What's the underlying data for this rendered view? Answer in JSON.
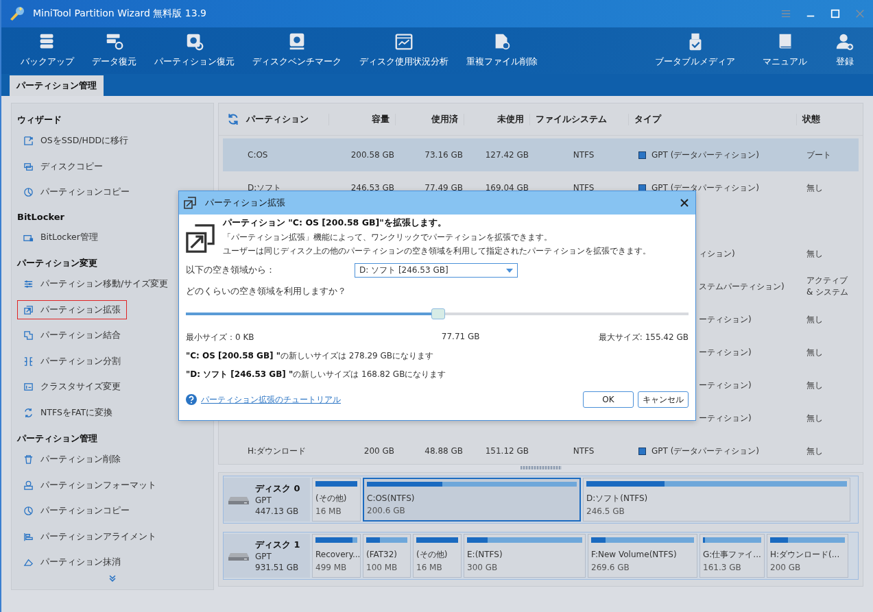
{
  "window": {
    "title": "MiniTool Partition Wizard 無料版 13.9"
  },
  "toolbar": {
    "left": [
      "バックアップ",
      "データ復元",
      "パーティション復元",
      "ディスクベンチマーク",
      "ディスク使用状況分析",
      "重複ファイル削除"
    ],
    "right": [
      "ブータブルメディア",
      "マニュアル",
      "登録"
    ]
  },
  "tabs": [
    {
      "label": "パーティション管理",
      "selected": true
    }
  ],
  "sidebar": [
    {
      "heading": "ウィザード",
      "items": [
        {
          "label": "OSをSSD/HDDに移行",
          "selected": false
        },
        {
          "label": "ディスクコピー",
          "selected": false
        },
        {
          "label": "パーティションコピー",
          "selected": false
        }
      ]
    },
    {
      "heading": "BitLocker",
      "items": [
        {
          "label": "BitLocker管理",
          "selected": false
        }
      ]
    },
    {
      "heading": "パーティション変更",
      "items": [
        {
          "label": "パーティション移動/サイズ変更",
          "selected": false
        },
        {
          "label": "パーティション拡張",
          "selected": true
        },
        {
          "label": "パーティション結合",
          "selected": false
        },
        {
          "label": "パーティション分割",
          "selected": false
        },
        {
          "label": "クラスタサイズ変更",
          "selected": false
        },
        {
          "label": "NTFSをFATに変換",
          "selected": false
        }
      ]
    },
    {
      "heading": "パーティション管理",
      "items": [
        {
          "label": "パーティション削除",
          "selected": false
        },
        {
          "label": "パーティションフォーマット",
          "selected": false
        },
        {
          "label": "パーティションコピー",
          "selected": false
        },
        {
          "label": "パーティションアライメント",
          "selected": false
        },
        {
          "label": "パーティション抹消",
          "selected": false
        }
      ]
    }
  ],
  "table": {
    "columns": [
      "パーティション",
      "容量",
      "使用済",
      "未使用",
      "ファイルシステム",
      "タイプ",
      "状態"
    ],
    "rows": [
      {
        "partition": "C:OS",
        "capacity": "200.58 GB",
        "used": "73.16 GB",
        "unused": "127.42 GB",
        "filesystem": "NTFS",
        "type": "GPT (データパーティション)",
        "status": "ブート",
        "selected": true
      },
      {
        "partition": "D:ソフト",
        "capacity": "246.53 GB",
        "used": "77.49 GB",
        "unused": "169.04 GB",
        "filesystem": "NTFS",
        "type": "GPT (データパーティション)",
        "status": "無し",
        "selected": false
      },
      {
        "type": "ィション)",
        "status": "無し"
      },
      {
        "type": "ステムパーティション)",
        "status": "アクティブ & システム"
      },
      {
        "type": "ーティション)",
        "status": "無し"
      },
      {
        "type": "ーティション)",
        "status": "無し"
      },
      {
        "type": "ーティション)",
        "status": "無し"
      },
      {
        "type": "ーティション)",
        "status": "無し"
      },
      {
        "partition": "H:ダウンロード",
        "capacity": "200 GB",
        "used": "48.88 GB",
        "unused": "151.12 GB",
        "filesystem": "NTFS",
        "type": "GPT (データパーティション)",
        "status": "無し",
        "selected": false
      }
    ]
  },
  "disks": [
    {
      "name": "ディスク 0",
      "style": "GPT",
      "size": "447.13 GB",
      "partitions": [
        {
          "label": "(その他)",
          "size": "16 MB",
          "level": 1.0,
          "selected": false
        },
        {
          "label": "C:OS(NTFS)",
          "size": "200.6 GB",
          "level": 0.36,
          "selected": true
        },
        {
          "label": "D:ソフト(NTFS)",
          "size": "246.5 GB",
          "level": 0.3,
          "selected": false
        }
      ]
    },
    {
      "name": "ディスク 1",
      "style": "GPT",
      "size": "931.51 GB",
      "partitions": [
        {
          "label": "Recovery...",
          "size": "499 MB",
          "level": 0.88,
          "selected": false
        },
        {
          "label": "(FAT32)",
          "size": "100 MB",
          "level": 0.33,
          "selected": false
        },
        {
          "label": "(その他)",
          "size": "16 MB",
          "level": 1.0,
          "selected": false
        },
        {
          "label": "E:(NTFS)",
          "size": "300 GB",
          "level": 0.18,
          "selected": false
        },
        {
          "label": "F:New Volume(NTFS)",
          "size": "269.6 GB",
          "level": 0.14,
          "selected": false
        },
        {
          "label": "G:仕事ファイ...",
          "size": "161.3 GB",
          "level": 0.03,
          "selected": false
        },
        {
          "label": "H:ダウンロード(...",
          "size": "200 GB",
          "level": 0.24,
          "selected": false
        }
      ]
    }
  ],
  "dialog": {
    "title": "パーティション拡張",
    "heading": "パーティション \"C: OS [200.58 GB]\"を拡張します。",
    "description": [
      "「パーティション拡張」機能によって、ワンクリックでパーティションを拡張できます。",
      "ユーザーは同じディスク上の他のパーティションの空き領域を利用して指定されたパーティションを拡張できます。"
    ],
    "source_label": "以下の空き領域から：",
    "source_value": "D: ソフト [246.53 GB]",
    "question": "どのくらいの空き領域を利用しますか？",
    "slider": {
      "level": 0.5
    },
    "min_label": "最小サイズ：0 KB",
    "current": "77.71 GB",
    "max_label": "最大サイズ: 155.42 GB",
    "results": [
      "**\"C: OS [200.58 GB] \"**の新しいサイズは 278.29 GBになります",
      "**\"D: ソフト [246.53 GB] \"**の新しいサイズは 168.82 GBになります"
    ],
    "help_link": "パーティション拡張のチュートリアル",
    "buttons": [
      "OK",
      "キャンセル"
    ]
  }
}
